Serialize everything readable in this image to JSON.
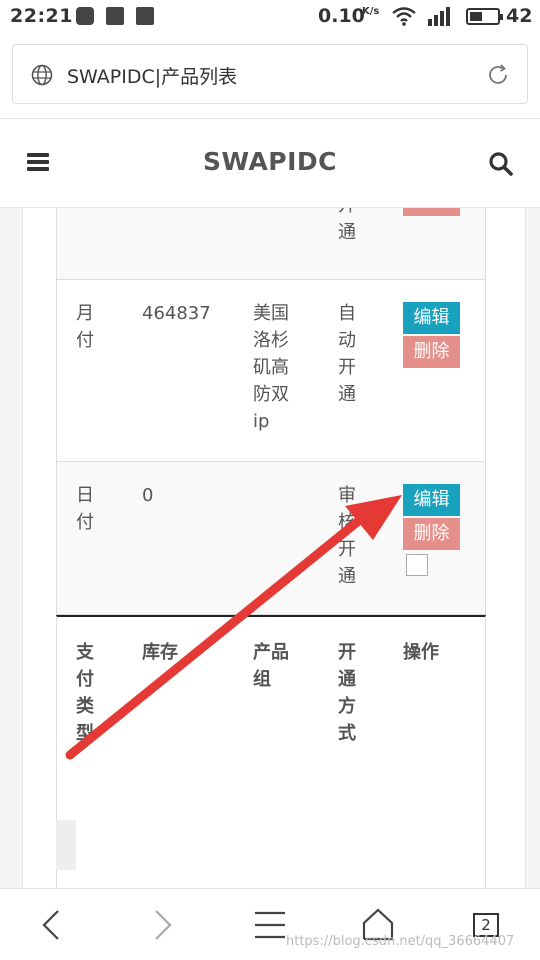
{
  "status_bar": {
    "time": "22:21",
    "speed": "0.10",
    "speed_unit": "K/s",
    "battery_level": "42"
  },
  "url_bar": {
    "url_text": "SWAPIDC|产品列表"
  },
  "header": {
    "brand": "SWAPIDC"
  },
  "table": {
    "partial_row": {
      "method": "开\n通"
    },
    "rows": [
      {
        "payment_type": "月\n付",
        "stock": "464837",
        "product_group": "美国\n洛杉\n矶高\n防双\nip",
        "activation": "自\n动\n开\n通",
        "edit_label": "编辑",
        "delete_label": "删除"
      },
      {
        "payment_type": "日\n付",
        "stock": "0",
        "product_group": "",
        "activation": "审\n核\n开\n通",
        "edit_label": "编辑",
        "delete_label": "删除"
      }
    ],
    "headers": {
      "payment_type": "支\n付\n类\n型",
      "stock": "库存",
      "product_group": "产品\n组",
      "activation": "开\n通\n方\n式",
      "actions": "操作"
    }
  },
  "bottom_nav": {
    "tab_count": "2"
  },
  "watermark": "https://blog.csdn.net/qq_36664407",
  "colors": {
    "edit_button": "#18a2bd",
    "delete_button": "#e58f8a",
    "arrow": "#e53935"
  }
}
